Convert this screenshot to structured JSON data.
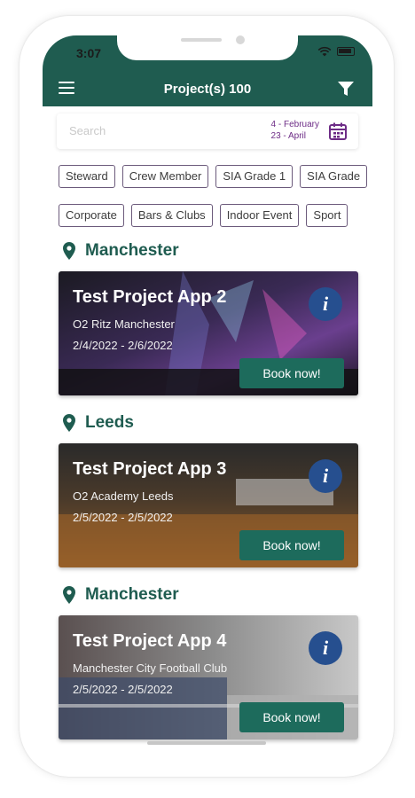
{
  "status_bar": {
    "time": "3:07"
  },
  "header": {
    "title": "Project(s) 100"
  },
  "search": {
    "placeholder": "Search",
    "date_from": "4 - February",
    "date_to": "23 - April"
  },
  "chips_row1": [
    "Steward",
    "Crew Member",
    "SIA Grade 1",
    "SIA Grade"
  ],
  "chips_row2": [
    "Corporate",
    "Bars & Clubs",
    "Indoor Event",
    "Sport"
  ],
  "sections": [
    {
      "location": "Manchester",
      "card": {
        "title": "Test Project App 2",
        "venue": "O2 Ritz Manchester",
        "dates": "2/4/2022 - 2/6/2022",
        "info": "i",
        "book": "Book now!"
      }
    },
    {
      "location": "Leeds",
      "card": {
        "title": "Test Project App 3",
        "venue": "O2 Academy Leeds",
        "dates": "2/5/2022 - 2/5/2022",
        "info": "i",
        "book": "Book now!"
      }
    },
    {
      "location": "Manchester",
      "card": {
        "title": "Test Project App 4",
        "venue": "Manchester City Football Club",
        "dates": "2/5/2022 - 2/5/2022",
        "info": "i",
        "book": "Book now!"
      }
    }
  ],
  "colors": {
    "header": "#1f5c50",
    "accent": "#6d2c86",
    "info": "#264f8f",
    "book": "#1d6b5c"
  }
}
